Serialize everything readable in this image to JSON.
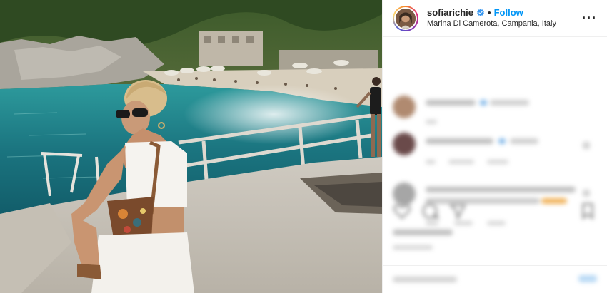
{
  "post": {
    "username": "sofiarichie",
    "follow_label": "Follow",
    "separator": "•",
    "location": "Marina Di Camerota, Campania, Italy",
    "more_label": "···"
  },
  "colors": {
    "link_blue": "#0095f6",
    "verified_blue": "#3897f0",
    "sea": "#1f7f86",
    "text": "#262626"
  },
  "icons": {
    "verified": "verified-badge-icon",
    "more": "more-options-icon",
    "like": "heart-icon",
    "comment": "comment-icon",
    "share": "share-icon",
    "save": "bookmark-icon"
  }
}
